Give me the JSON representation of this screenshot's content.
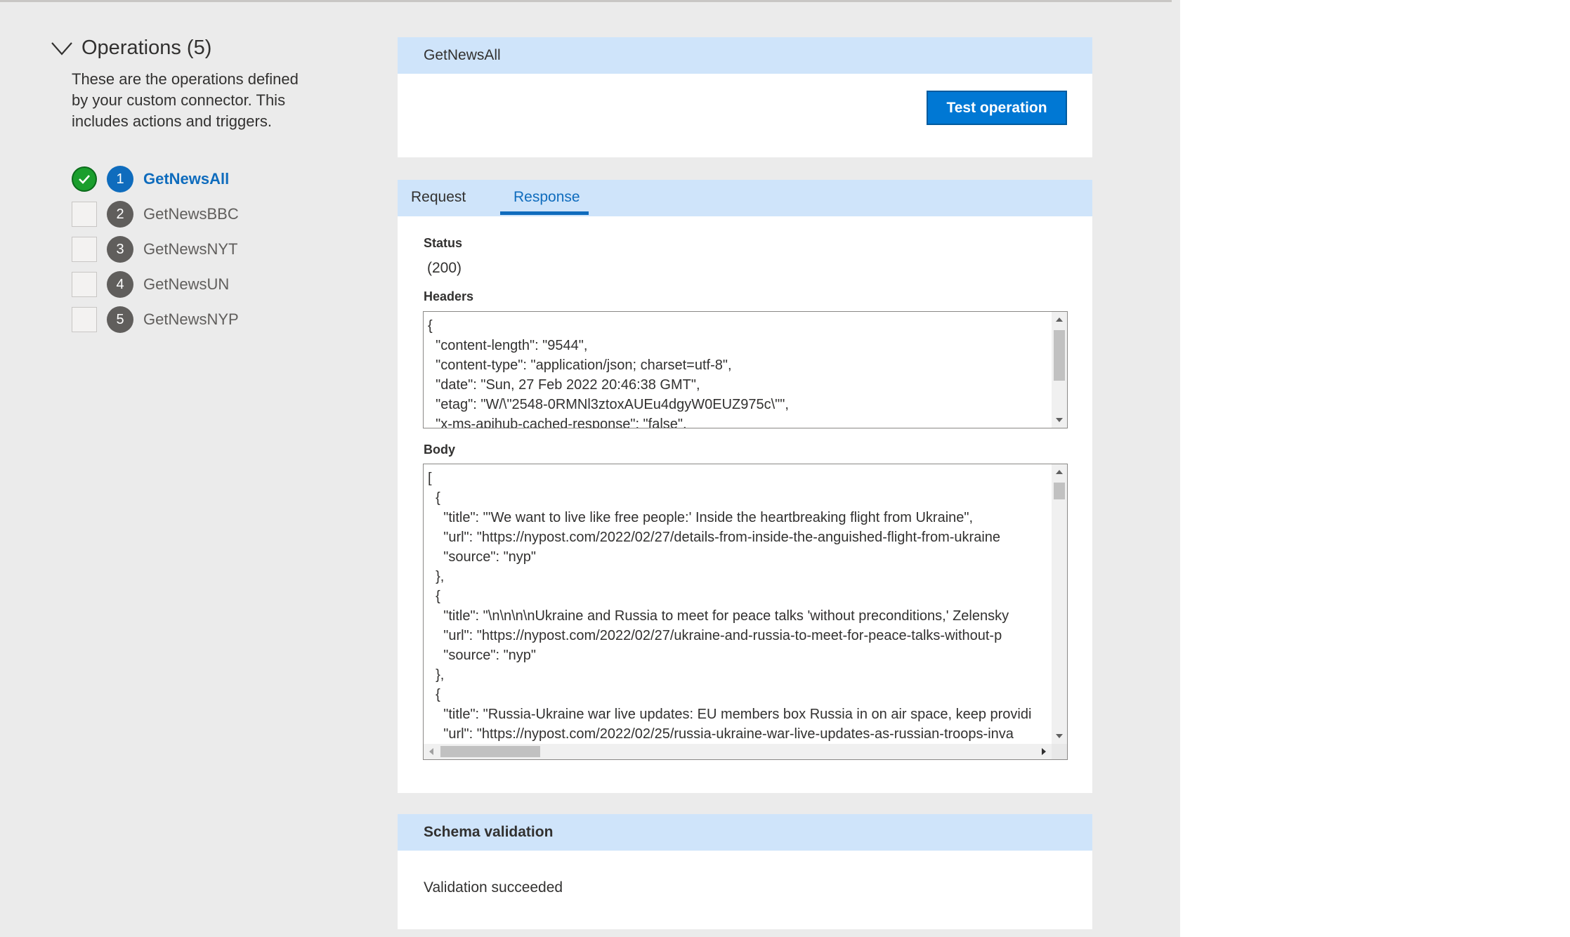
{
  "operations": {
    "title": "Operations (5)",
    "description": "These are the operations defined by your custom connector. This includes actions and triggers.",
    "items": [
      {
        "number": "1",
        "name": "GetNewsAll",
        "status": "complete",
        "active": true
      },
      {
        "number": "2",
        "name": "GetNewsBBC",
        "status": "pending",
        "active": false
      },
      {
        "number": "3",
        "name": "GetNewsNYT",
        "status": "pending",
        "active": false
      },
      {
        "number": "4",
        "name": "GetNewsUN",
        "status": "pending",
        "active": false
      },
      {
        "number": "5",
        "name": "GetNewsNYP",
        "status": "pending",
        "active": false
      }
    ]
  },
  "test_card": {
    "title": "GetNewsAll",
    "button_label": "Test operation"
  },
  "response_card": {
    "tabs": [
      {
        "label": "Request",
        "selected": false
      },
      {
        "label": "Response",
        "selected": true
      }
    ],
    "status_label": "Status",
    "status_value": "(200)",
    "headers_label": "Headers",
    "headers_content": "{\n  \"content-length\": \"9544\",\n  \"content-type\": \"application/json; charset=utf-8\",\n  \"date\": \"Sun, 27 Feb 2022 20:46:38 GMT\",\n  \"etag\": \"W/\\\"2548-0RMNl3ztoxAUEu4dgyW0EUZ975c\\\"\",\n  \"x-ms-apihub-cached-response\": \"false\",",
    "body_label": "Body",
    "body_content": "[\n  {\n    \"title\": \"'We want to live like free people:' Inside the heartbreaking flight from Ukraine\",\n    \"url\": \"https://nypost.com/2022/02/27/details-from-inside-the-anguished-flight-from-ukraine\n    \"source\": \"nyp\"\n  },\n  {\n    \"title\": \"\\n\\n\\n\\nUkraine and Russia to meet for peace talks 'without preconditions,' Zelensky\n    \"url\": \"https://nypost.com/2022/02/27/ukraine-and-russia-to-meet-for-peace-talks-without-p\n    \"source\": \"nyp\"\n  },\n  {\n    \"title\": \"Russia-Ukraine war live updates: EU members box Russia in on air space, keep providi\n    \"url\": \"https://nypost.com/2022/02/25/russia-ukraine-war-live-updates-as-russian-troops-inva"
  },
  "schema_card": {
    "title": "Schema validation",
    "result": "Validation succeeded"
  },
  "colors": {
    "accent": "#0078d4",
    "card_header": "#cfe4fa",
    "success": "#1a9e2d",
    "page_background": "#ebebeb"
  }
}
